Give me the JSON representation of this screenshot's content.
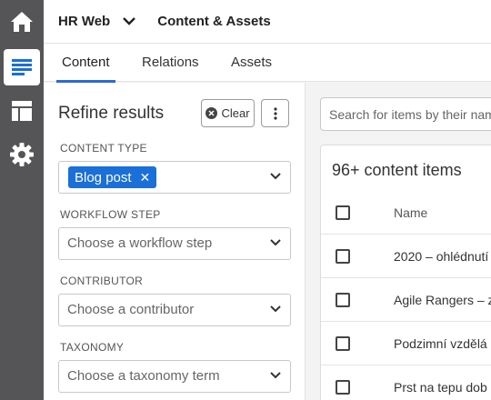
{
  "rail": [
    {
      "icon": "home-icon"
    },
    {
      "icon": "content-list-icon",
      "active": true
    },
    {
      "icon": "layout-icon"
    },
    {
      "icon": "gear-icon"
    }
  ],
  "header": {
    "project": "HR Web",
    "environment": "Content & Assets"
  },
  "tabs": [
    "Content",
    "Relations",
    "Assets"
  ],
  "filters": {
    "title": "Refine results",
    "clear_label": "Clear",
    "content_type": {
      "label": "CONTENT TYPE",
      "selected": "Blog post"
    },
    "workflow": {
      "label": "WORKFLOW STEP",
      "placeholder": "Choose a workflow step"
    },
    "contributor": {
      "label": "CONTRIBUTOR",
      "placeholder": "Choose a contributor"
    },
    "taxonomy": {
      "label": "TAXONOMY",
      "placeholder": "Choose a taxonomy term"
    }
  },
  "search": {
    "placeholder": "Search for items by their name"
  },
  "list": {
    "count": "96+ content items",
    "column_name": "Name",
    "rows": [
      "2020 – ohlédnutí",
      "Agile Rangers – z",
      "Podzimní vzdělá",
      "Prst na tepu dob"
    ]
  }
}
